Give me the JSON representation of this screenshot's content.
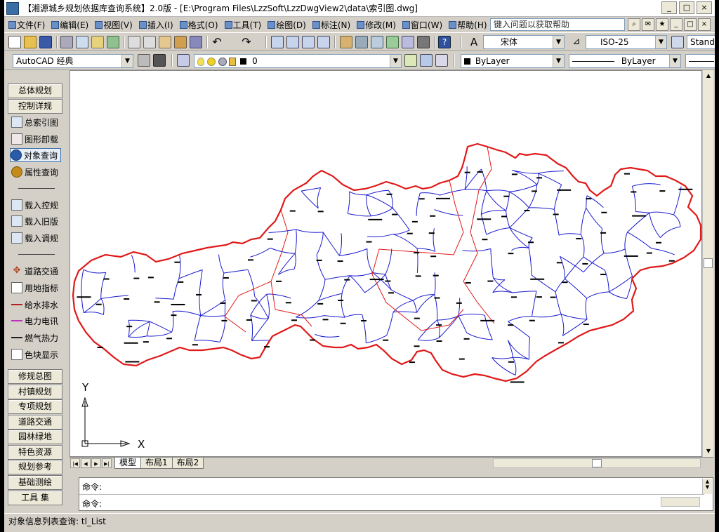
{
  "window": {
    "title": "【湘源城乡规划依据库查询系统】2.0版 - [E:\\Program Files\\LzzSoft\\LzzDwgView2\\data\\索引图.dwg]",
    "controls": [
      "_",
      "□",
      "×"
    ]
  },
  "menubar": {
    "items": [
      "文件(F)",
      "编辑(E)",
      "视图(V)",
      "插入(I)",
      "格式(O)",
      "工具(T)",
      "绘图(D)",
      "标注(N)",
      "修改(M)",
      "窗口(W)",
      "帮助(H)"
    ],
    "help_placeholder": "键入问题以获取帮助",
    "doc_controls": [
      "_",
      "□",
      "×"
    ]
  },
  "toolbar1": {
    "font_name": "宋体",
    "dim_style": "ISO-25",
    "text_style": "Standard"
  },
  "toolbar2": {
    "workspace": "AutoCAD 经典",
    "layer": "0",
    "color": "ByLayer",
    "linetype": "ByLayer"
  },
  "sidebar": {
    "top_buttons": [
      "总体规划",
      "控制详规"
    ],
    "items_a": [
      {
        "label": "总索引图",
        "icon": "index-map-icon"
      },
      {
        "label": "图形卸载",
        "icon": "unload-icon"
      },
      {
        "label": "对象查询",
        "icon": "info-icon",
        "selected": true
      },
      {
        "label": "属性查询",
        "icon": "property-icon"
      }
    ],
    "items_b": [
      {
        "label": "载入控规",
        "icon": "load-icon"
      },
      {
        "label": "载入旧版",
        "icon": "load-old-icon"
      },
      {
        "label": "载入调规",
        "icon": "load-adjust-icon"
      }
    ],
    "items_c": [
      {
        "label": "道路交通",
        "icon": "road-icon",
        "color": "#b04020"
      },
      {
        "label": "用地指标",
        "icon": "landuse-icon",
        "color": "#333333"
      },
      {
        "label": "给水排水",
        "icon": "water-icon",
        "color": "#b02020"
      },
      {
        "label": "电力电讯",
        "icon": "power-icon",
        "color": "#c030c0"
      },
      {
        "label": "燃气热力",
        "icon": "gas-icon",
        "color": "#202020"
      },
      {
        "label": "色块显示",
        "icon": "color-block-icon",
        "color": "#333333"
      }
    ],
    "bottom_buttons": [
      "修规总图",
      "村镇规划",
      "专项规划",
      "道路交通",
      "园林绿地",
      "特色资源",
      "规划参考",
      "基础测绘",
      "工具 集"
    ]
  },
  "canvas": {
    "background": "#ffffff",
    "boundary_color": "#e01818",
    "district_color": "#1a1ad0",
    "axis_y": "Y",
    "axis_x": "X"
  },
  "tabs": {
    "items": [
      "模型",
      "布局1",
      "布局2"
    ],
    "active": "模型"
  },
  "command": {
    "line1": "命令:",
    "line2": "命令:"
  },
  "status": {
    "text": "对象信息列表查询: tl_List"
  }
}
